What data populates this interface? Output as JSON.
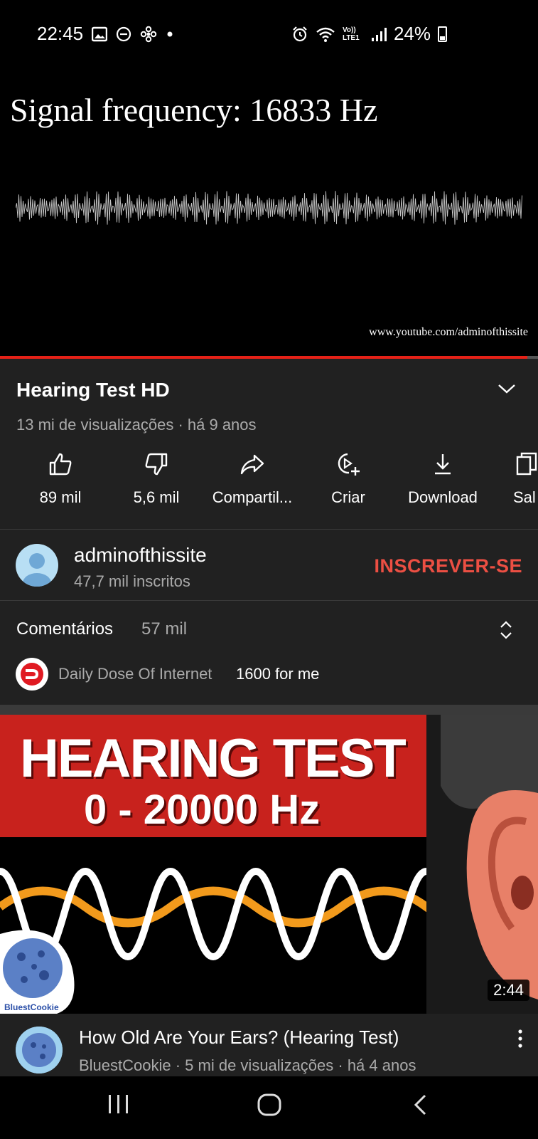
{
  "status_bar": {
    "time": "22:45",
    "left_icons": [
      "image-icon",
      "do-not-disturb-icon",
      "fan-icon",
      "dot-icon"
    ],
    "right_icons": [
      "alarm-icon",
      "wifi-icon",
      "volte-icon",
      "signal-icon",
      "battery-icon"
    ],
    "volte_text": "Vo)) LTE1",
    "battery": "24%"
  },
  "player": {
    "on_screen_text": "Signal frequency: 16833 Hz",
    "watermark": "www.youtube.com/adminofthissite",
    "progress": 0.98,
    "progress_color": "#e62117"
  },
  "video": {
    "title": "Hearing Test HD",
    "meta": "13 mi de visualizações · há 9 anos",
    "actions": [
      {
        "label": "89 mil",
        "icon": "like-icon"
      },
      {
        "label": "5,6 mil",
        "icon": "dislike-icon"
      },
      {
        "label": "Compartil...",
        "icon": "share-icon"
      },
      {
        "label": "Criar",
        "icon": "create-icon"
      },
      {
        "label": "Download",
        "icon": "download-icon"
      },
      {
        "label": "Sal",
        "icon": "save-icon"
      }
    ]
  },
  "channel": {
    "name": "adminofthissite",
    "subscribers": "47,7 mil inscritos",
    "subscribe_label": "INSCREVER-SE",
    "subscribe_color": "#ec4f43"
  },
  "comments": {
    "title": "Comentários",
    "count": "57 mil",
    "top_author": "Daily Dose Of Internet",
    "top_text": "1600 for me"
  },
  "next_video": {
    "thumb_line1": "HEARING TEST",
    "thumb_line2": "0 - 20000 Hz",
    "cookie_label": "BluestCookie",
    "duration": "2:44",
    "title": "How Old Are Your Ears? (Hearing Test)",
    "meta": "BluestCookie · 5 mi de visualizações · há 4 anos"
  },
  "nav": {
    "buttons": [
      "recent-apps-icon",
      "home-icon",
      "back-icon"
    ]
  }
}
